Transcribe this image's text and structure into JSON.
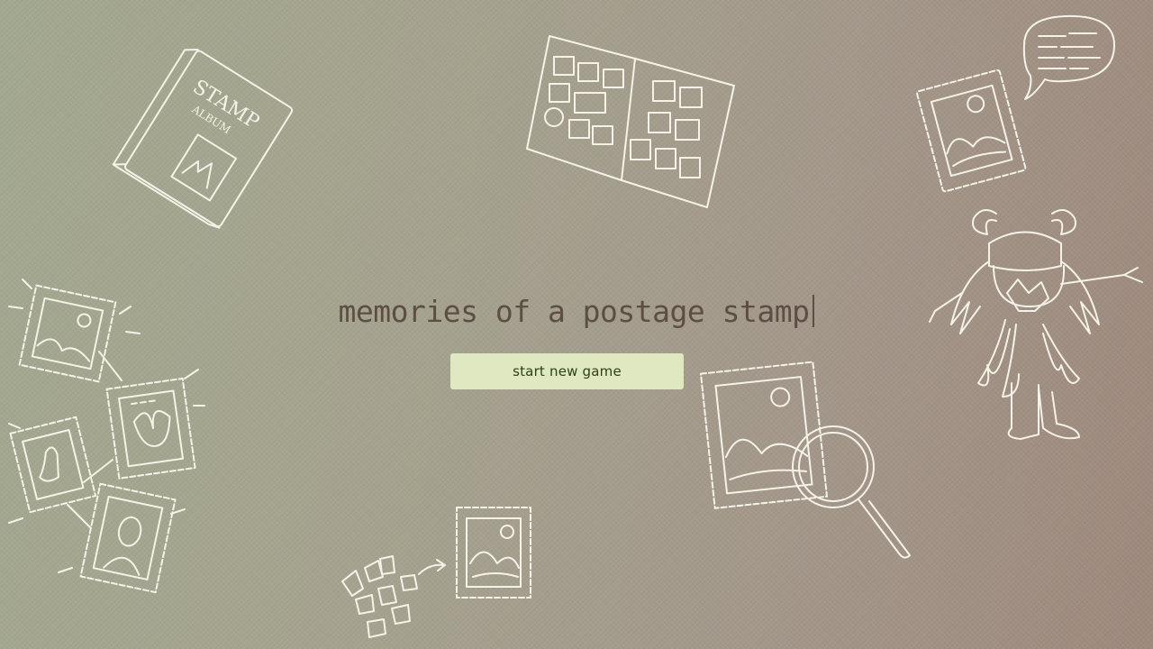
{
  "title": "memories of a postage stamp",
  "start_button_label": "start new game",
  "album_lettering": "STAMP ALBUM",
  "illustrations": [
    "stamp-album-icon",
    "open-album-icon",
    "stamp-speech-bubble-icon",
    "creature-icon",
    "stamp-network-icon",
    "torn-stamp-icon",
    "magnifier-stamp-icon"
  ],
  "colors": {
    "title": "#5c4e42",
    "button_bg": "#dfe8c0",
    "button_text": "#2d4018",
    "line_art": "#f5f3e8"
  }
}
